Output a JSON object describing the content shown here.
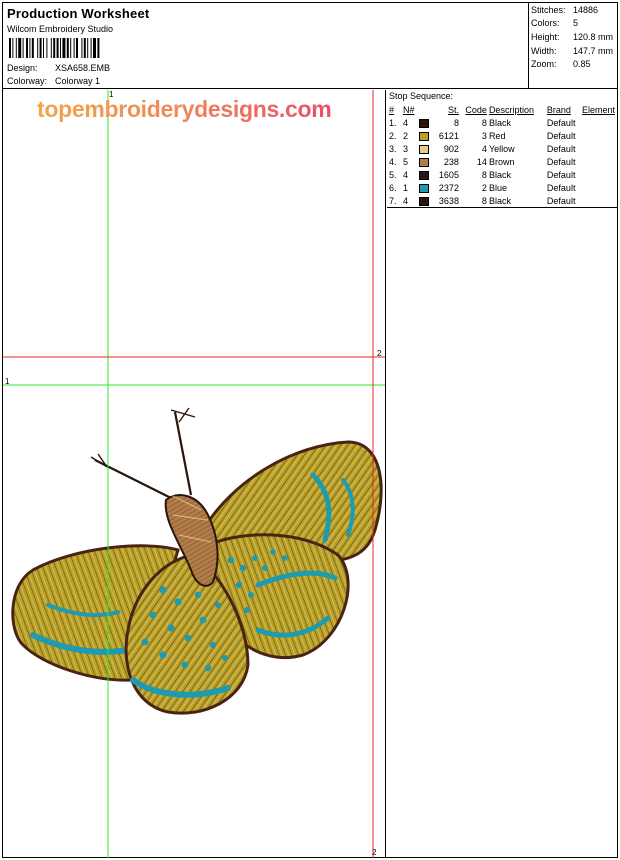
{
  "header": {
    "title": "Production Worksheet",
    "software": "Wilcom  Embroidery Studio",
    "design_label": "Design:",
    "design_value": "XSA658.EMB",
    "colorway_label": "Colorway:",
    "colorway_value": "Colorway 1"
  },
  "stats": {
    "stitches_label": "Stitches:",
    "stitches_value": "14886",
    "colors_label": "Colors:",
    "colors_value": "5",
    "height_label": "Height:",
    "height_value": "120.8 mm",
    "width_label": "Width:",
    "width_value": "147.7 mm",
    "zoom_label": "Zoom:",
    "zoom_value": "0.85"
  },
  "design": {
    "watermark": "topembroiderydesigns.com",
    "guide_labels": {
      "green_top": "1",
      "green_left": "1",
      "red_right": "2",
      "red_bottom": "2"
    },
    "colors": {
      "black": "#2a160c",
      "red": "#b9a126",
      "yellow": "#e9cc86",
      "brown": "#b27c49",
      "blue": "#1e9bb0",
      "guide_green": "#2ee82e",
      "guide_red": "#e02828"
    }
  },
  "stop_sequence": {
    "title": "Stop Sequence:",
    "columns": [
      "#",
      "N#",
      "St.",
      "Code",
      "Description",
      "Brand",
      "Element"
    ],
    "rows": [
      {
        "idx": "1.",
        "n": "4",
        "color": "#2a160c",
        "st": "8",
        "code": "8",
        "desc": "Black",
        "brand": "Default",
        "element": ""
      },
      {
        "idx": "2.",
        "n": "2",
        "color": "#b9a126",
        "st": "6121",
        "code": "3",
        "desc": "Red",
        "brand": "Default",
        "element": ""
      },
      {
        "idx": "3.",
        "n": "3",
        "color": "#e9cc86",
        "st": "902",
        "code": "4",
        "desc": "Yellow",
        "brand": "Default",
        "element": ""
      },
      {
        "idx": "4.",
        "n": "5",
        "color": "#b27c49",
        "st": "238",
        "code": "14",
        "desc": "Brown",
        "brand": "Default",
        "element": ""
      },
      {
        "idx": "5.",
        "n": "4",
        "color": "#2a160c",
        "st": "1605",
        "code": "8",
        "desc": "Black",
        "brand": "Default",
        "element": ""
      },
      {
        "idx": "6.",
        "n": "1",
        "color": "#1e9bb0",
        "st": "2372",
        "code": "2",
        "desc": "Blue",
        "brand": "Default",
        "element": ""
      },
      {
        "idx": "7.",
        "n": "4",
        "color": "#2a160c",
        "st": "3638",
        "code": "8",
        "desc": "Black",
        "brand": "Default",
        "element": ""
      }
    ]
  }
}
